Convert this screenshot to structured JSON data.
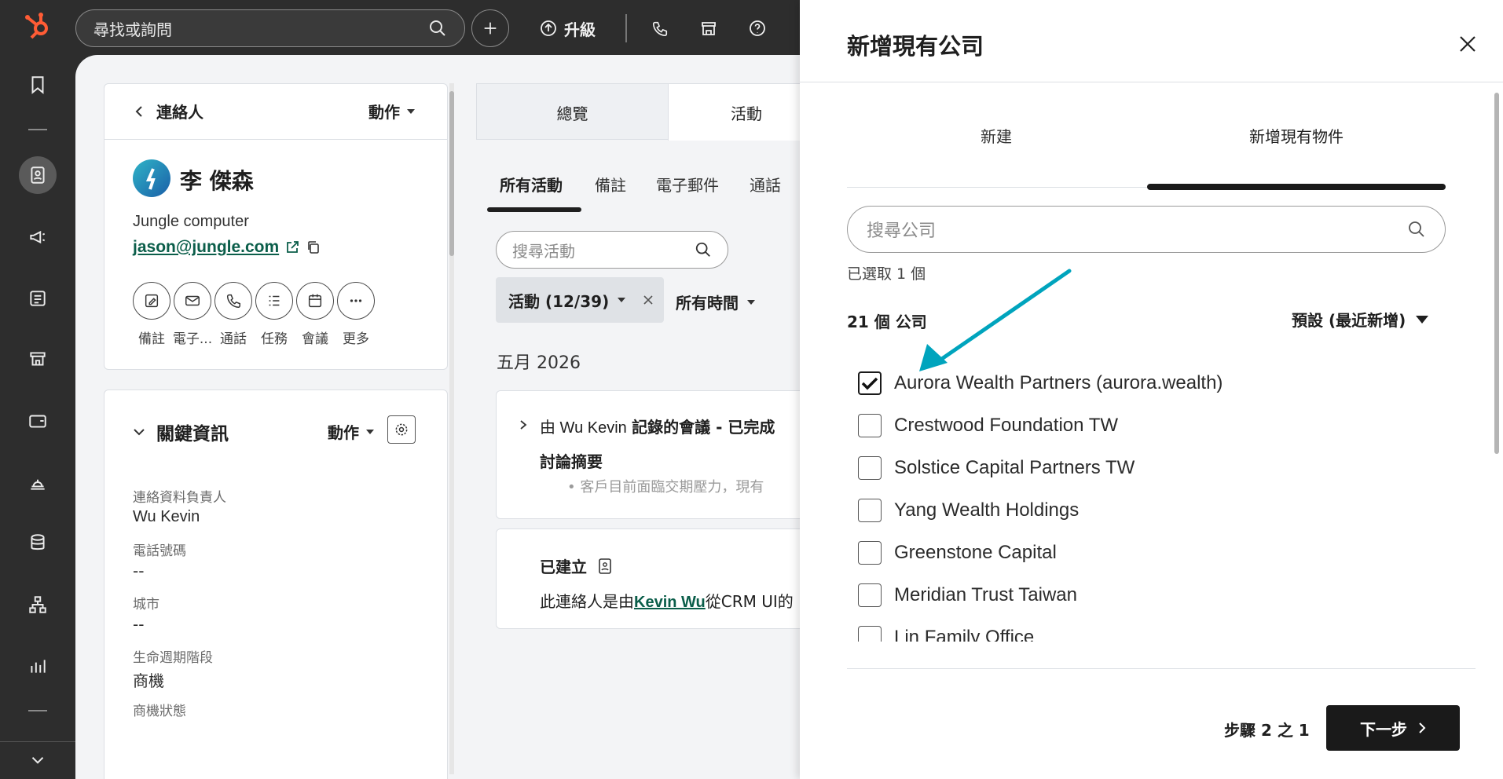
{
  "topbar": {
    "search_placeholder": "尋找或詢問",
    "upgrade_label": "升級"
  },
  "contact_card": {
    "back_label": "連絡人",
    "actions_label": "動作",
    "name": "李 傑森",
    "company": "Jungle computer",
    "email": "jason@jungle.com",
    "quick_actions": [
      {
        "label": "備註",
        "icon": "note-icon"
      },
      {
        "label": "電子...",
        "icon": "email-icon"
      },
      {
        "label": "通話",
        "icon": "phone-icon"
      },
      {
        "label": "任務",
        "icon": "task-icon"
      },
      {
        "label": "會議",
        "icon": "meeting-icon"
      },
      {
        "label": "更多",
        "icon": "more-icon"
      }
    ]
  },
  "key_info": {
    "title": "關鍵資訊",
    "actions_label": "動作",
    "fields": [
      {
        "label": "連絡資料負責人",
        "value": "Wu Kevin"
      },
      {
        "label": "電話號碼",
        "value": "--"
      },
      {
        "label": "城市",
        "value": "--"
      },
      {
        "label": "生命週期階段",
        "value": "商機"
      },
      {
        "label": "商機狀態",
        "value": ""
      }
    ]
  },
  "center": {
    "main_tabs": [
      "總覽",
      "活動"
    ],
    "sub_tabs": [
      "所有活動",
      "備註",
      "電子郵件",
      "通話"
    ],
    "search_placeholder": "搜尋活動",
    "filter_activity": "活動 (12/39)",
    "filter_time": "所有時間",
    "month_header": "五月 2026",
    "activity1": {
      "prefix": "由 Wu Kevin",
      "title": "記錄的會議 - 已完成",
      "subtitle": "討論摘要",
      "bullet": "客戶目前面臨交期壓力，現有"
    },
    "activity2": {
      "title": "已建立",
      "text_before": "此連絡人是由",
      "link": "Kevin Wu",
      "text_after": "從CRM UI的"
    }
  },
  "panel": {
    "title": "新增現有公司",
    "tabs": [
      "新建",
      "新增現有物件"
    ],
    "search_placeholder": "搜尋公司",
    "selected_count": "已選取 1 個",
    "result_count": "21 個 公司",
    "sort_label": "預設 (最近新增)",
    "companies": [
      {
        "name": "Aurora Wealth Partners (aurora.wealth)",
        "checked": true
      },
      {
        "name": "Crestwood Foundation TW",
        "checked": false
      },
      {
        "name": "Solstice Capital Partners TW",
        "checked": false
      },
      {
        "name": "Yang Wealth Holdings",
        "checked": false
      },
      {
        "name": "Greenstone Capital",
        "checked": false
      },
      {
        "name": "Meridian Trust Taiwan",
        "checked": false
      },
      {
        "name": "Lin Family Office",
        "checked": false
      }
    ],
    "step_label": "步驟 2 之 1",
    "next_label": "下一步"
  },
  "colors": {
    "brand_orange": "#ff5c35",
    "accent_teal": "#00a4bd",
    "link_green": "#0b5e4a"
  }
}
